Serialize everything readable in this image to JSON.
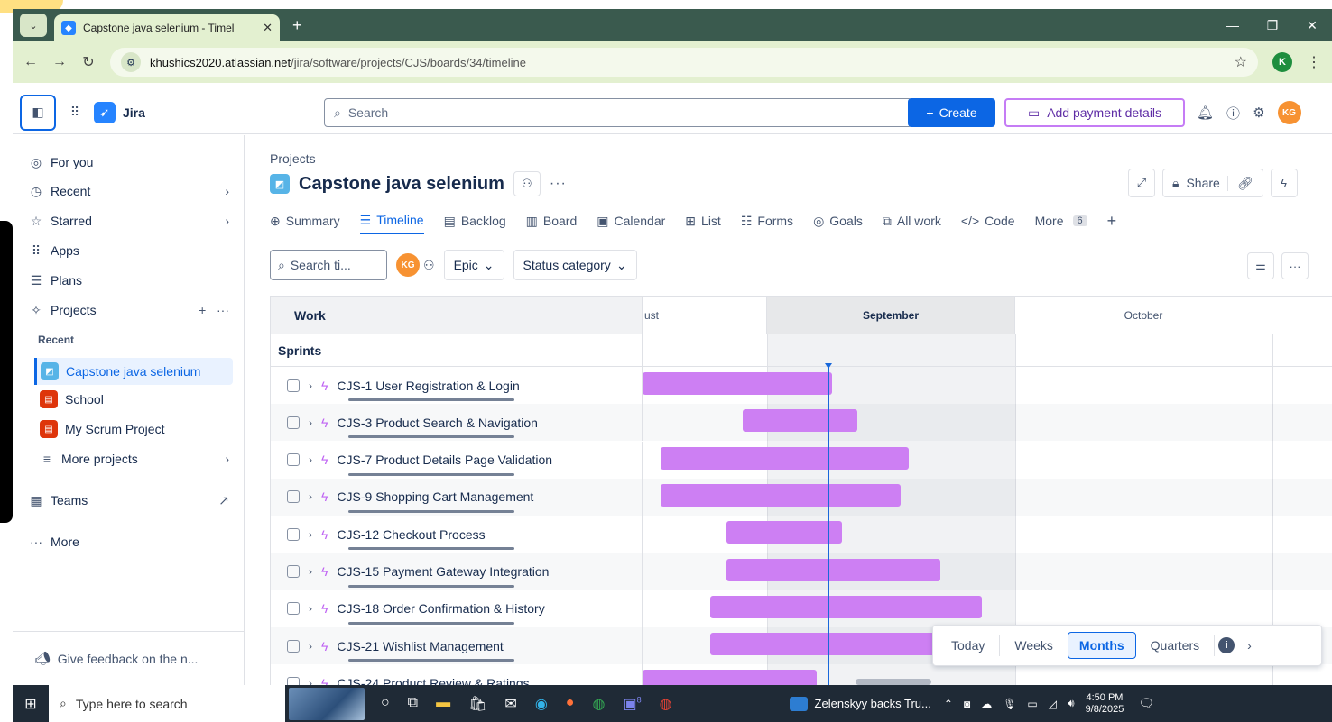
{
  "browser": {
    "tab_title": "Capstone java selenium - Timel",
    "url_host": "khushics2020.atlassian.net",
    "url_path": "/jira/software/projects/CJS/boards/34/timeline",
    "profile_initial": "K"
  },
  "topnav": {
    "product_name": "Jira",
    "search_placeholder": "Search",
    "create_label": "Create",
    "payment_label": "Add payment details",
    "avatar_initials": "KG"
  },
  "sidebar": {
    "for_you": "For you",
    "recent": "Recent",
    "starred": "Starred",
    "apps": "Apps",
    "plans": "Plans",
    "projects": "Projects",
    "recent_label": "Recent",
    "project_items": [
      {
        "name": "Capstone java selenium",
        "color": "#57b4e7"
      },
      {
        "name": "School",
        "color": "#de350b"
      },
      {
        "name": "My Scrum Project",
        "color": "#de350b"
      }
    ],
    "more_projects": "More projects",
    "teams": "Teams",
    "more": "More",
    "feedback": "Give feedback on the n..."
  },
  "header": {
    "breadcrumb": "Projects",
    "title": "Capstone java selenium",
    "share_label": "Share"
  },
  "tabs": [
    {
      "label": "Summary",
      "icon": "globe-icon"
    },
    {
      "label": "Timeline",
      "icon": "timeline-icon",
      "active": true
    },
    {
      "label": "Backlog",
      "icon": "backlog-icon"
    },
    {
      "label": "Board",
      "icon": "board-icon"
    },
    {
      "label": "Calendar",
      "icon": "calendar-icon"
    },
    {
      "label": "List",
      "icon": "list-icon"
    },
    {
      "label": "Forms",
      "icon": "forms-icon"
    },
    {
      "label": "Goals",
      "icon": "goals-icon"
    },
    {
      "label": "All work",
      "icon": "all-work-icon"
    },
    {
      "label": "Code",
      "icon": "code-icon"
    }
  ],
  "more_tab": {
    "label": "More",
    "count": "6"
  },
  "filters": {
    "search_placeholder": "Search ti...",
    "avatar_initials": "KG",
    "epic_label": "Epic",
    "status_label": "Status category"
  },
  "timeline": {
    "work_header": "Work",
    "months": [
      "ust",
      "September",
      "October"
    ],
    "sprints_label": "Sprints",
    "rows": [
      {
        "key_title": "CJS-1 User Registration & Login",
        "start": 0.0,
        "end": 0.764
      },
      {
        "key_title": "CJS-3 Product Search & Navigation",
        "start": 0.404,
        "end": 0.865
      },
      {
        "key_title": "CJS-7 Product Details Page Validation",
        "start": 0.073,
        "end": 1.073
      },
      {
        "key_title": "CJS-9 Shopping Cart Management",
        "start": 0.073,
        "end": 1.04
      },
      {
        "key_title": "CJS-12 Checkout Process",
        "start": 0.338,
        "end": 0.804
      },
      {
        "key_title": "CJS-15 Payment Gateway Integration",
        "start": 0.338,
        "end": 1.2
      },
      {
        "key_title": "CJS-18 Order Confirmation & History",
        "start": 0.273,
        "end": 1.367
      },
      {
        "key_title": "CJS-21 Wishlist Management",
        "start": 0.273,
        "end": 1.2
      },
      {
        "key_title": "CJS-24 Product Review & Ratings",
        "start": 0.0,
        "end": 0.702
      }
    ]
  },
  "zoom": {
    "today": "Today",
    "weeks": "Weeks",
    "months": "Months",
    "quarters": "Quarters"
  },
  "taskbar": {
    "search_placeholder": "Type here to search",
    "news": "Zelenskyy backs Tru...",
    "time": "4:50 PM",
    "date": "9/8/2025",
    "teams_badge": "8"
  }
}
